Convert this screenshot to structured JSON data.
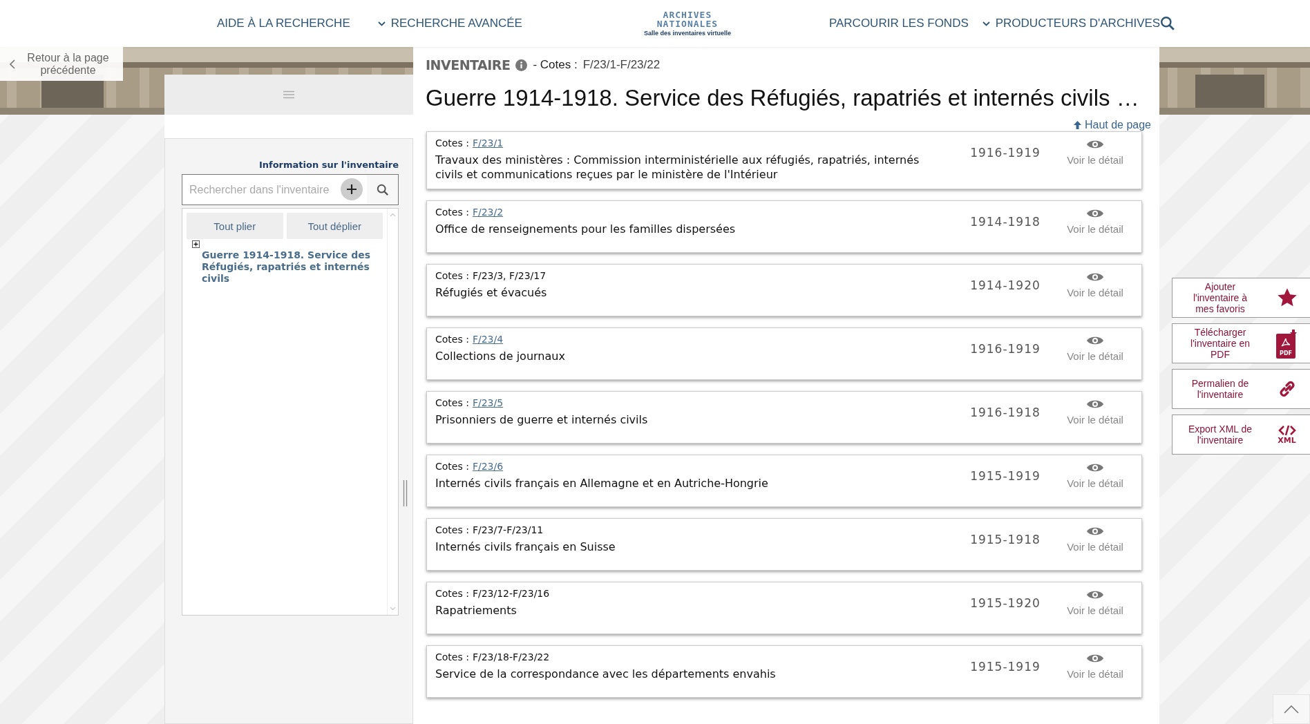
{
  "header": {
    "nav": [
      {
        "label": "AIDE À LA RECHERCHE",
        "dropdown": false
      },
      {
        "label": "RECHERCHE AVANCÉE",
        "dropdown": true
      },
      {
        "label": "PARCOURIR LES FONDS",
        "dropdown": false
      },
      {
        "label": "PRODUCTEURS D'ARCHIVES",
        "dropdown": true
      }
    ],
    "logo": {
      "title": "ARCHIVES NATIONALES",
      "subtitle": "Salle des inventaires virtuelle"
    }
  },
  "back_button": "Retour à la page précédente",
  "sidebar": {
    "info_link": "Information sur l'inventaire",
    "search": {
      "placeholder": "Rechercher dans l'inventaire"
    },
    "buttons": [
      "Tout plier",
      "Tout déplier"
    ],
    "tree": [
      {
        "label": "Guerre 1914-1918. Service des Réfugiés, rapatriés et internés civils",
        "expanded": false
      }
    ]
  },
  "inventory": {
    "label": "INVENTAIRE",
    "cotes_label": "- Cotes :",
    "cotes": "F/23/1-F/23/22",
    "title": "Guerre 1914-1918. Service des Réfugiés, rapatriés et internés civils …",
    "top_link": "Haut de page"
  },
  "records": [
    {
      "cotes_label": "Cotes :",
      "cotes": "F/23/1",
      "linked": true,
      "title": "Travaux des ministères : Commission interministérielle aux réfugiés, rapatriés, internés civils et communications reçues par le ministère de l'Intérieur",
      "dates": "1916-1919",
      "action": "Voir le détail"
    },
    {
      "cotes_label": "Cotes :",
      "cotes": "F/23/2",
      "linked": true,
      "title": "Office de renseignements pour les familles dispersées",
      "dates": "1914-1918",
      "action": "Voir le détail"
    },
    {
      "cotes_label": "Cotes :",
      "cotes": "F/23/3, F/23/17",
      "linked": false,
      "title": "Réfugiés et évacués",
      "dates": "1914-1920",
      "action": "Voir le détail"
    },
    {
      "cotes_label": "Cotes :",
      "cotes": "F/23/4",
      "linked": true,
      "title": "Collections de journaux",
      "dates": "1916-1919",
      "action": "Voir le détail"
    },
    {
      "cotes_label": "Cotes :",
      "cotes": "F/23/5",
      "linked": true,
      "title": "Prisonniers de guerre et internés civils",
      "dates": "1916-1918",
      "action": "Voir le détail"
    },
    {
      "cotes_label": "Cotes :",
      "cotes": "F/23/6",
      "linked": true,
      "title": "Internés civils français en Allemagne et en Autriche-Hongrie",
      "dates": "1915-1919",
      "action": "Voir le détail"
    },
    {
      "cotes_label": "Cotes :",
      "cotes": "F/23/7-F/23/11",
      "linked": false,
      "title": "Internés civils français en Suisse",
      "dates": "1915-1918",
      "action": "Voir le détail"
    },
    {
      "cotes_label": "Cotes :",
      "cotes": "F/23/12-F/23/16",
      "linked": false,
      "title": "Rapatriements",
      "dates": "1915-1920",
      "action": "Voir le détail"
    },
    {
      "cotes_label": "Cotes :",
      "cotes": "F/23/18-F/23/22",
      "linked": false,
      "title": "Service de la correspondance avec les départements envahis",
      "dates": "1915-1919",
      "action": "Voir le détail"
    }
  ],
  "actions": [
    {
      "kind": "star",
      "label": "Ajouter l'inventaire à mes favoris"
    },
    {
      "kind": "pdf",
      "label": "Télécharger l'inventaire en PDF",
      "badge": "PDF"
    },
    {
      "kind": "link",
      "label": "Permalien de l'inventaire"
    },
    {
      "kind": "xml",
      "label": "Export XML de l'inventaire",
      "badge": "XML"
    }
  ]
}
